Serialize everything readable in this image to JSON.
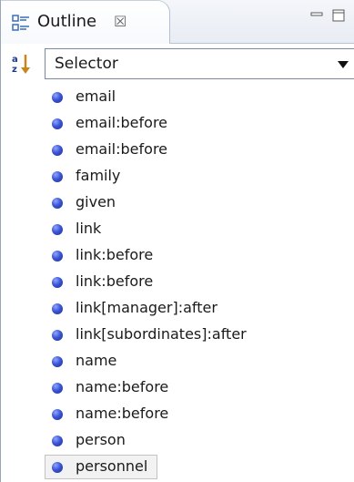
{
  "tab": {
    "label": "Outline",
    "close_glyph": "☒",
    "icon": "outline-icon"
  },
  "window": {
    "minimize_icon": "minimize-icon",
    "maximize_icon": "maximize-icon"
  },
  "toolbar": {
    "sort_icon": "sort-az-icon",
    "selector": {
      "value": "Selector"
    }
  },
  "items": [
    {
      "label": "email"
    },
    {
      "label": "email:before"
    },
    {
      "label": "email:before"
    },
    {
      "label": "family"
    },
    {
      "label": "given"
    },
    {
      "label": "link"
    },
    {
      "label": "link:before"
    },
    {
      "label": "link:before"
    },
    {
      "label": "link[manager]:after"
    },
    {
      "label": "link[subordinates]:after"
    },
    {
      "label": "name"
    },
    {
      "label": "name:before"
    },
    {
      "label": "name:before"
    },
    {
      "label": "person"
    },
    {
      "label": "personnel",
      "selected": true
    }
  ],
  "colors": {
    "bullet": "#3c55d6",
    "border": "#7a8aa5"
  }
}
